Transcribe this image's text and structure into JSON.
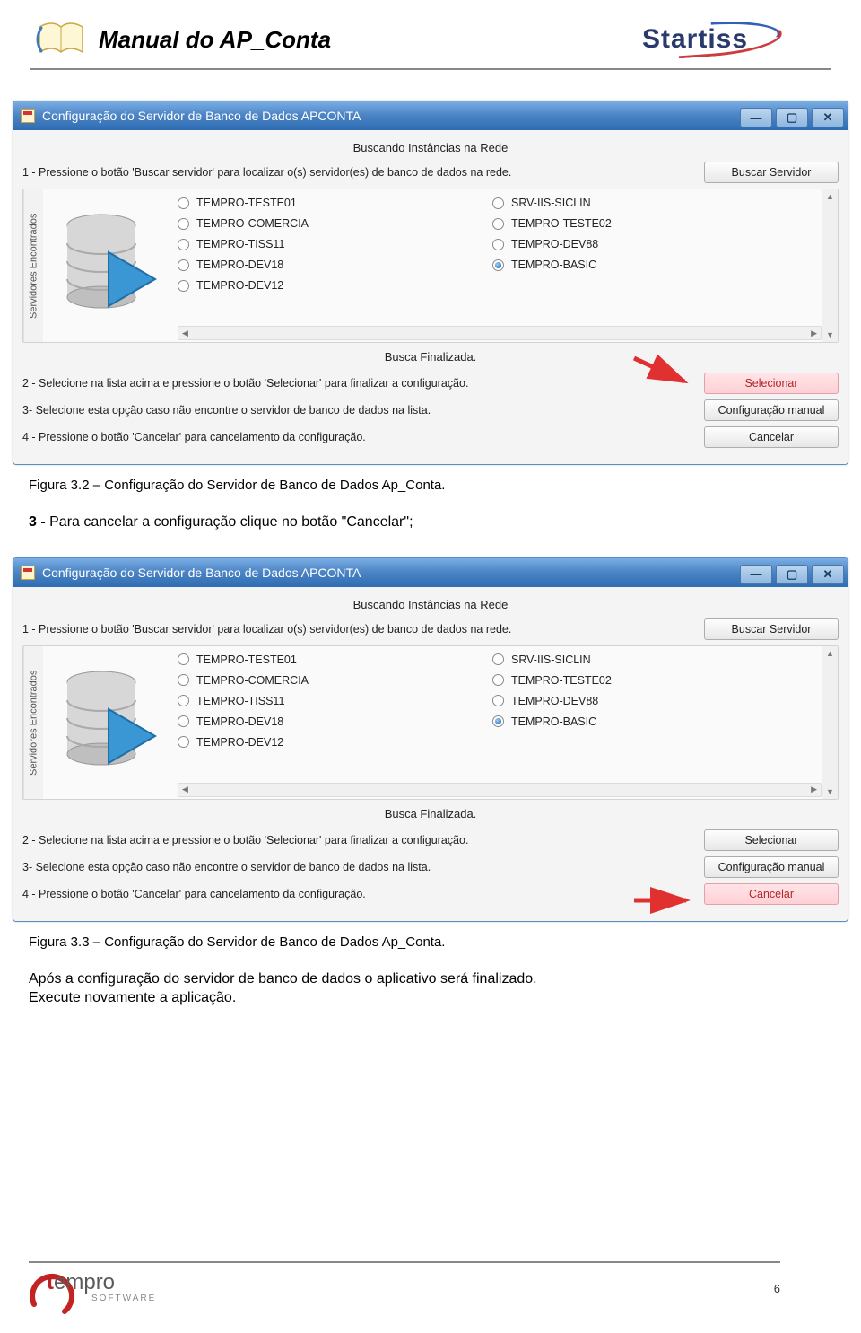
{
  "header": {
    "title": "Manual do AP_Conta",
    "logo_text": "Startiss"
  },
  "window": {
    "title": "Configuração do Servidor de Banco de Dados APCONTA",
    "searching_label": "Buscando Instâncias na Rede",
    "step1": "1 - Pressione o botão 'Buscar servidor' para localizar o(s) servidor(es) de banco de dados na rede.",
    "buscar_btn": "Buscar Servidor",
    "servers_label": "Servidores Encontrados",
    "servers_col1": [
      "TEMPRO-TESTE01",
      "TEMPRO-COMERCIA",
      "TEMPRO-TISS11",
      "TEMPRO-DEV18",
      "TEMPRO-DEV12"
    ],
    "servers_col2": [
      "SRV-IIS-SICLIN",
      "TEMPRO-TESTE02",
      "TEMPRO-DEV88",
      "TEMPRO-BASIC"
    ],
    "selected": "TEMPRO-BASIC",
    "status": "Busca Finalizada.",
    "step2": "2 - Selecione na lista acima e pressione o botão 'Selecionar' para finalizar a configuração.",
    "selecionar_btn": "Selecionar",
    "step3": "3- Selecione esta opção caso não encontre o servidor de banco de dados na lista.",
    "config_btn": "Configuração manual",
    "step4": "4 - Pressione o botão 'Cancelar'  para cancelamento da configuração.",
    "cancelar_btn": "Cancelar"
  },
  "captions": {
    "fig32": "Figura 3.2 – Configuração do Servidor de Banco de Dados Ap_Conta.",
    "fig33": "Figura 3.3 – Configuração do Servidor de Banco de Dados Ap_Conta."
  },
  "body": {
    "para1": "3 - Para cancelar a configuração clique no botão \"Cancelar\";",
    "para2a": "Após a configuração do servidor de banco de dados o aplicativo será finalizado.",
    "para2b": "Execute novamente a aplicação."
  },
  "footer": {
    "logo_main": "empro",
    "logo_sub": "SOFTWARE",
    "page": "6"
  }
}
